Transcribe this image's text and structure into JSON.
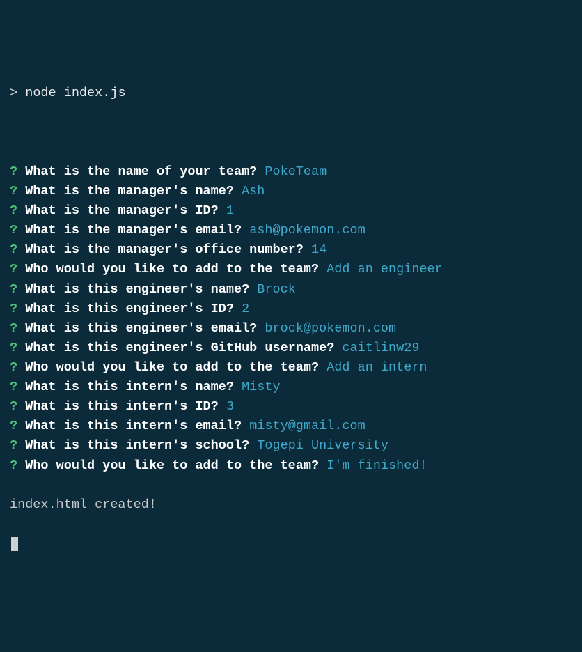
{
  "command": {
    "prompt": ">",
    "text": "node index.js"
  },
  "lines": [
    {
      "mark": "?",
      "question": "What is the name of your team?",
      "answer": "PokeTeam"
    },
    {
      "mark": "?",
      "question": "What is the manager's name?",
      "answer": "Ash"
    },
    {
      "mark": "?",
      "question": "What is the manager's ID?",
      "answer": "1"
    },
    {
      "mark": "?",
      "question": "What is the manager's email?",
      "answer": "ash@pokemon.com"
    },
    {
      "mark": "?",
      "question": "What is the manager's office number?",
      "answer": "14"
    },
    {
      "mark": "?",
      "question": "Who would you like to add to the team?",
      "answer": "Add an engineer"
    },
    {
      "mark": "?",
      "question": "What is this engineer's name?",
      "answer": "Brock"
    },
    {
      "mark": "?",
      "question": "What is this engineer's ID?",
      "answer": "2"
    },
    {
      "mark": "?",
      "question": "What is this engineer's email?",
      "answer": "brock@pokemon.com"
    },
    {
      "mark": "?",
      "question": "What is this engineer's GitHub username?",
      "answer": "caitlinw29"
    },
    {
      "mark": "?",
      "question": "Who would you like to add to the team?",
      "answer": "Add an intern"
    },
    {
      "mark": "?",
      "question": "What is this intern's name?",
      "answer": "Misty"
    },
    {
      "mark": "?",
      "question": "What is this intern's ID?",
      "answer": "3"
    },
    {
      "mark": "?",
      "question": "What is this intern's email?",
      "answer": "misty@gmail.com"
    },
    {
      "mark": "?",
      "question": "What is this intern's school?",
      "answer": "Togepi University"
    },
    {
      "mark": "?",
      "question": "Who would you like to add to the team?",
      "answer": "I'm finished!"
    }
  ],
  "footer": "index.html created!"
}
